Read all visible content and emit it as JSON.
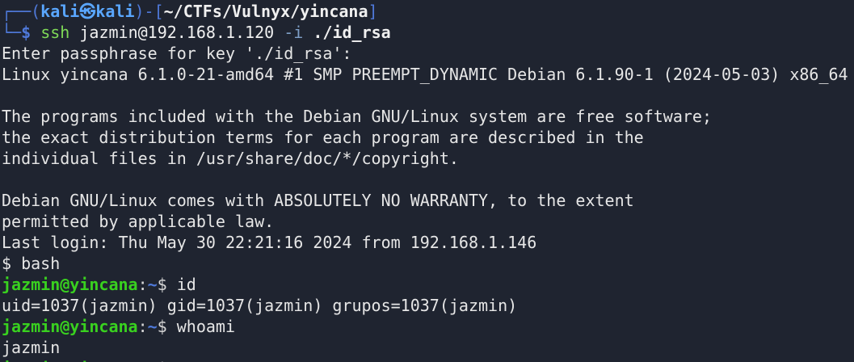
{
  "kali_prompt": {
    "top_left": "┌──(",
    "user": "kali",
    "at_symbol": "㉿",
    "host": "kali",
    "mid": ")-[",
    "path": "~/CTFs/Vulnyx/yincana",
    "close": "]",
    "bottom_left": "└─",
    "dollar": "$",
    "command": "ssh",
    "arg1": "jazmin@192.168.1.120",
    "flag": "-i",
    "key_file": "./id_rsa"
  },
  "output": {
    "passphrase": "Enter passphrase for key './id_rsa':",
    "uname": "Linux yincana 6.1.0-21-amd64 #1 SMP PREEMPT_DYNAMIC Debian 6.1.90-1 (2024-05-03) x86_64",
    "blank1": "",
    "motd1": "The programs included with the Debian GNU/Linux system are free software;",
    "motd2": "the exact distribution terms for each program are described in the",
    "motd3": "individual files in /usr/share/doc/*/copyright.",
    "blank2": "",
    "warranty1": "Debian GNU/Linux comes with ABSOLUTELY NO WARRANTY, to the extent",
    "warranty2": "permitted by applicable law.",
    "last_login": "Last login: Thu May 30 22:21:16 2024 from 192.168.1.146",
    "sh_prompt": "$ bash"
  },
  "session": {
    "user_host": "jazmin@yincana",
    "sep": ":",
    "dir": "~",
    "dollar": "$ ",
    "cmd1": "id",
    "cmd1_output": "uid=1037(jazmin) gid=1037(jazmin) grupos=1037(jazmin)",
    "cmd2": "whoami",
    "cmd2_output": "jazmin"
  }
}
